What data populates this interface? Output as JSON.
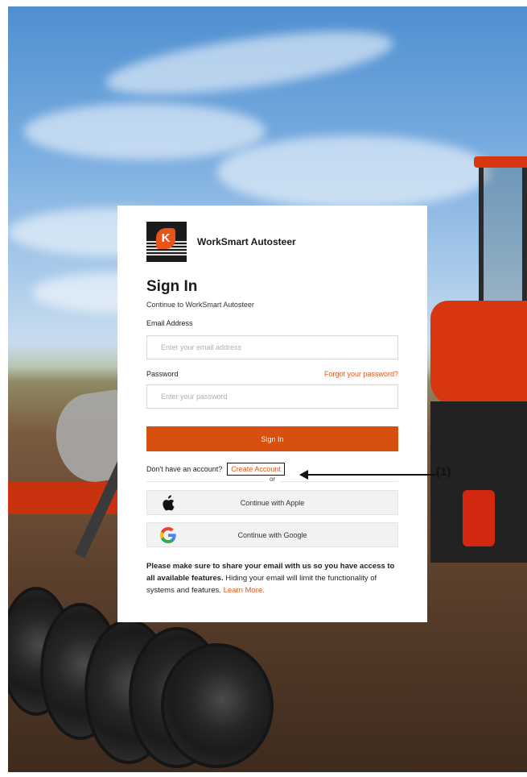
{
  "app": {
    "logo_letter": "K",
    "name": "WorkSmart Autosteer"
  },
  "signin": {
    "title": "Sign In",
    "subtitle": "Continue to WorkSmart Autosteer",
    "email_label": "Email Address",
    "email_placeholder": "Enter your email address",
    "email_value": "",
    "password_label": "Password",
    "forgot_label": "Forgot your password?",
    "password_placeholder": "Enter your password",
    "password_value": "",
    "submit_label": "Sign In"
  },
  "account": {
    "prompt": "Don't have an account?",
    "create_label": "Create Account"
  },
  "divider_text": "or",
  "social": {
    "apple_label": "Continue with Apple",
    "google_label": "Continue with Google",
    "apple_icon": "apple-icon",
    "google_icon": "google-icon"
  },
  "notice": {
    "bold": "Please make sure to share your email with us so you have access to all available features.",
    "text": " Hiding your email will limit the functionality of systems and features. ",
    "link": "Learn More."
  },
  "callout": {
    "label": "(1)"
  },
  "colors": {
    "accent": "#d7500f",
    "link": "#e0561b",
    "social_bg": "#f2f2f2"
  }
}
